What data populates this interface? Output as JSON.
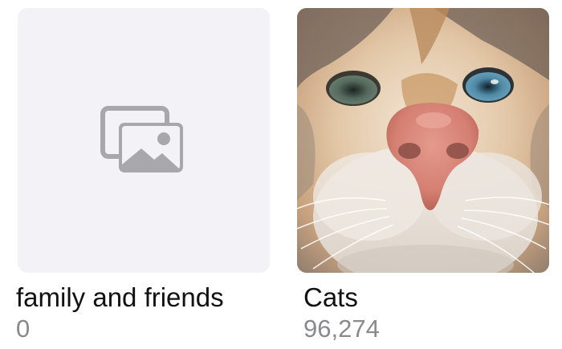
{
  "albums": [
    {
      "title": "family and friends",
      "count": "0",
      "thumbnail": "placeholder",
      "icon": "photo-stack-icon"
    },
    {
      "title": "Cats",
      "count": "96,274",
      "thumbnail": "cat-closeup-photo"
    }
  ],
  "colors": {
    "placeholder_bg": "#f2f2f7",
    "placeholder_icon": "#a8a8ac",
    "title_text": "#111111",
    "count_text": "#8a8a8e"
  }
}
